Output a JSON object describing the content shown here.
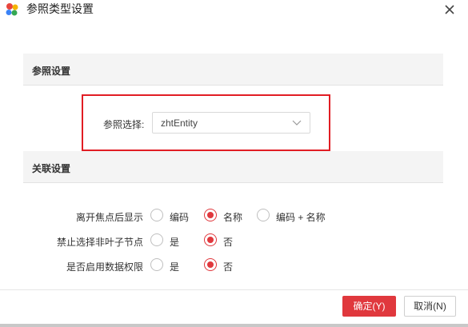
{
  "window": {
    "title": "参照类型设置",
    "logo_icon": "app-logo-icon",
    "close_label": "✕"
  },
  "sections": {
    "reference": {
      "title": "参照设置"
    },
    "relation": {
      "title": "关联设置"
    }
  },
  "reference": {
    "label": "参照选择:",
    "selected_value": "zhtEntity"
  },
  "relation": {
    "rows": [
      {
        "label": "离开焦点后显示",
        "options": [
          "编码",
          "名称",
          "编码 + 名称"
        ],
        "selected": 1
      },
      {
        "label": "禁止选择非叶子节点",
        "options": [
          "是",
          "否"
        ],
        "selected": 1
      },
      {
        "label": "是否启用数据权限",
        "options": [
          "是",
          "否"
        ],
        "selected": 1
      }
    ]
  },
  "footer": {
    "ok_label": "确定(Y)",
    "cancel_label": "取消(N)"
  },
  "colors": {
    "accent": "#e0383d",
    "highlight_border": "#e11d24",
    "section_bg": "#f4f4f4"
  }
}
